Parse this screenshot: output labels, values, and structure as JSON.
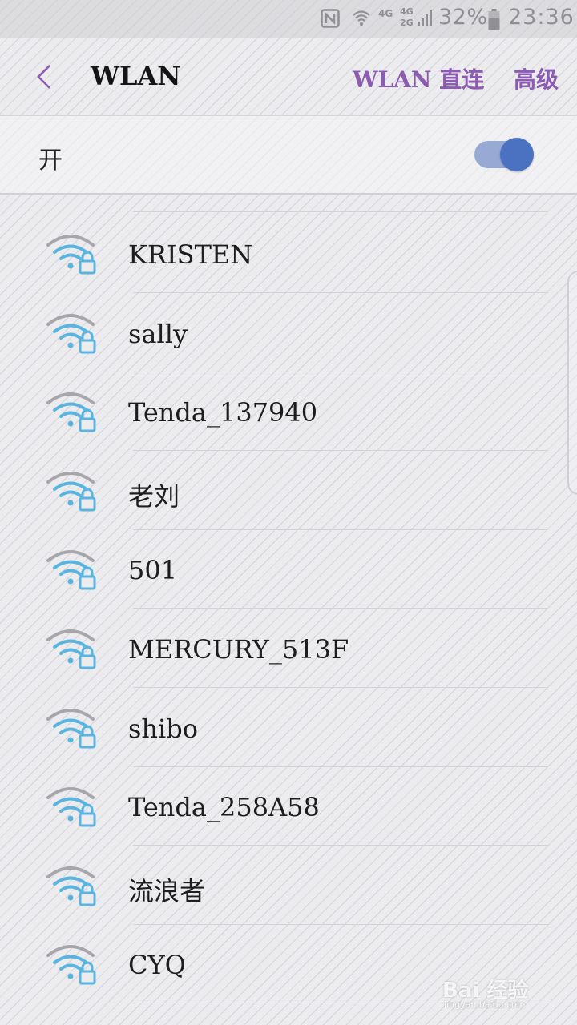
{
  "status_bar": {
    "net_type_1": "4G",
    "net_type_2a": "4G",
    "net_type_2b": "2G",
    "battery_percent": "32%",
    "time": "23:36",
    "icons": [
      "nfc-icon",
      "wifi-signal-icon",
      "cell-signal-icon",
      "battery-icon"
    ]
  },
  "header": {
    "title": "WLAN",
    "direct_label": "WLAN 直连",
    "advanced_label": "高级",
    "accent_color": "#8c5cb3"
  },
  "toggle": {
    "label": "开",
    "on": true,
    "color": "#4a72c0"
  },
  "networks": [
    {
      "ssid": "KRISTEN",
      "secured": true
    },
    {
      "ssid": "sally",
      "secured": true
    },
    {
      "ssid": "Tenda_137940",
      "secured": true
    },
    {
      "ssid": "老刘",
      "secured": true
    },
    {
      "ssid": "501",
      "secured": true
    },
    {
      "ssid": "MERCURY_513F",
      "secured": true
    },
    {
      "ssid": "shibo",
      "secured": true
    },
    {
      "ssid": "Tenda_258A58",
      "secured": true
    },
    {
      "ssid": "流浪者",
      "secured": true
    },
    {
      "ssid": "CYQ",
      "secured": true
    }
  ],
  "wifi_colors": {
    "strong": "#5ab4e0",
    "weak": "#a7a7ab"
  },
  "watermark": {
    "main": "Bai 经验",
    "sub": "jingyan.baidu.com"
  }
}
